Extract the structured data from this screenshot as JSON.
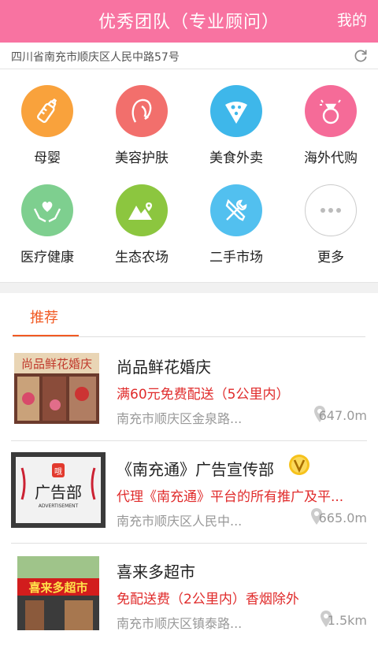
{
  "header": {
    "title": "优秀团队（专业顾问）",
    "mine": "我的",
    "bg_color": "#f873a1"
  },
  "address": {
    "text": "四川省南充市顺庆区人民中路57号",
    "refresh_icon": "refresh-icon"
  },
  "categories": [
    {
      "label": "母婴",
      "color": "#f9a23c",
      "icon": "baby-bottle-icon"
    },
    {
      "label": "美容护肤",
      "color": "#f26f6c",
      "icon": "woman-face-icon"
    },
    {
      "label": "美食外卖",
      "color": "#3eb7ea",
      "icon": "pizza-icon"
    },
    {
      "label": "海外代购",
      "color": "#f56b98",
      "icon": "diamond-ring-icon"
    },
    {
      "label": "医疗健康",
      "color": "#7ecf8f",
      "icon": "heart-hands-icon"
    },
    {
      "label": "生态农场",
      "color": "#8cc63f",
      "icon": "mountain-pin-icon"
    },
    {
      "label": "二手市场",
      "color": "#52c0ef",
      "icon": "tools-icon"
    },
    {
      "label": "更多",
      "color": "#ffffff",
      "icon": "more-icon"
    }
  ],
  "tabs": {
    "active": "推荐",
    "accent": "#f15a23"
  },
  "listings": [
    {
      "name": "尚品鲜花婚庆",
      "promo": "满60元免费配送（5公里内）",
      "location": "南充市顺庆区金泉路...",
      "distance": "647.0m",
      "verified": false,
      "thumb_text": "尚品鲜花婚庆"
    },
    {
      "name": "《南充通》广告宣传部",
      "promo": "代理《南充通》平台的所有推广及平...",
      "location": "南充市顺庆区人民中...",
      "distance": "665.0m",
      "verified": true,
      "thumb_text": "广告部",
      "thumb_subtext": "ADVERTISEMENT"
    },
    {
      "name": "喜来多超市",
      "promo": "免配送费（2公里内）香烟除外",
      "location": "南充市顺庆区镇泰路...",
      "distance": "1.5km",
      "verified": false,
      "thumb_text": "喜来多超市"
    }
  ]
}
